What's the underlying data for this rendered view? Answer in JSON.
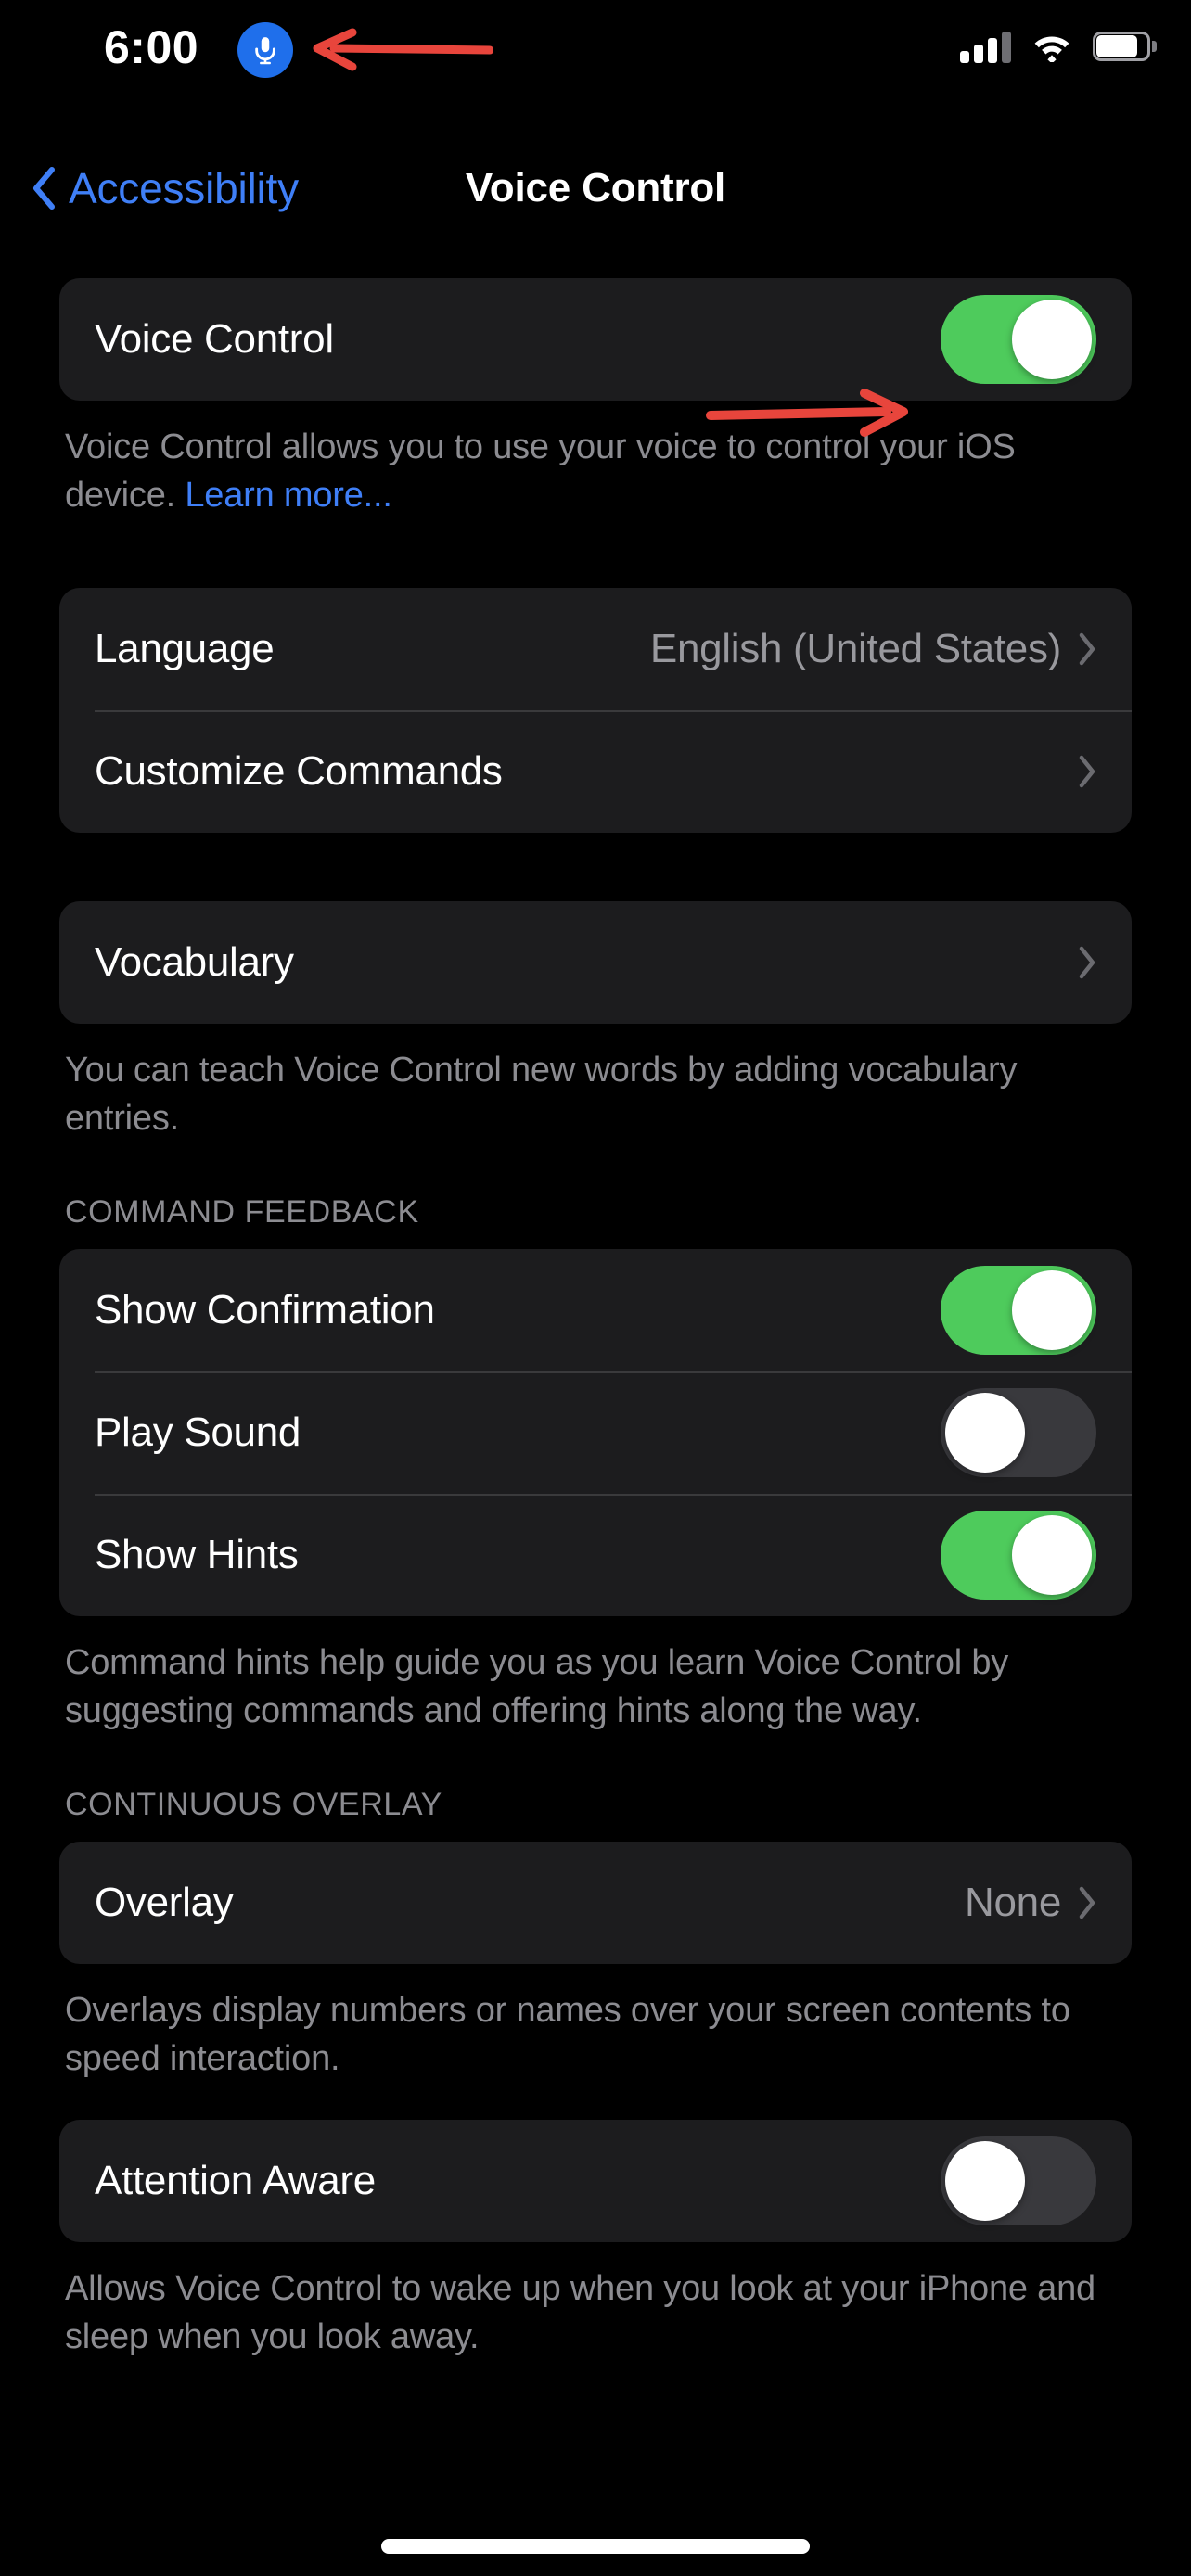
{
  "status_bar": {
    "time": "6:00",
    "mic_indicator_icon": "microphone-icon",
    "mic_indicator_color": "#1F6FEB",
    "cellular_icon": "cellular-signal-icon",
    "cellular_bars_filled": 3,
    "cellular_bars_total": 4,
    "wifi_icon": "wifi-icon",
    "battery_icon": "battery-icon",
    "battery_level_percent": 80
  },
  "nav": {
    "back_icon": "chevron-left-icon",
    "back_label": "Accessibility",
    "title": "Voice Control",
    "back_color": "#3F7FF7"
  },
  "sections": {
    "main_toggle": {
      "label": "Voice Control",
      "value": "on",
      "footer_text": "Voice Control allows you to use your voice to control your iOS device. ",
      "footer_link": "Learn more..."
    },
    "language": {
      "rows": [
        {
          "label": "Language",
          "value": "English (United States)",
          "accessory": "chevron-right-icon"
        },
        {
          "label": "Customize Commands",
          "value": "",
          "accessory": "chevron-right-icon"
        }
      ]
    },
    "vocabulary": {
      "rows": [
        {
          "label": "Vocabulary",
          "value": "",
          "accessory": "chevron-right-icon"
        }
      ],
      "footer_text": "You can teach Voice Control new words by adding vocabulary entries."
    },
    "command_feedback": {
      "header": "COMMAND FEEDBACK",
      "rows": [
        {
          "label": "Show Confirmation",
          "value": "on"
        },
        {
          "label": "Play Sound",
          "value": "off"
        },
        {
          "label": "Show Hints",
          "value": "on"
        }
      ],
      "footer_text": "Command hints help guide you as you learn Voice Control by suggesting commands and offering hints along the way."
    },
    "continuous_overlay": {
      "header": "CONTINUOUS OVERLAY",
      "rows": [
        {
          "label": "Overlay",
          "value": "None",
          "accessory": "chevron-right-icon"
        }
      ],
      "footer_text": "Overlays display numbers or names over your screen contents to speed interaction."
    },
    "attention_aware": {
      "rows": [
        {
          "label": "Attention Aware",
          "value": "off"
        }
      ],
      "footer_text": "Allows Voice Control to wake up when you look at your iPhone and sleep when you look away."
    }
  },
  "annotations": {
    "color": "#E8453C",
    "arrow_status_bar": "arrow-pointing-left-at-mic-indicator",
    "arrow_toggle": "arrow-pointing-right-at-voice-control-toggle"
  },
  "colors": {
    "page_background": "#000000",
    "card_background": "#1C1C1E",
    "toggle_on": "#4ECB5C",
    "toggle_off": "#39393D",
    "secondary_text": "#8C8C91",
    "accent_blue": "#3F7FF7"
  }
}
